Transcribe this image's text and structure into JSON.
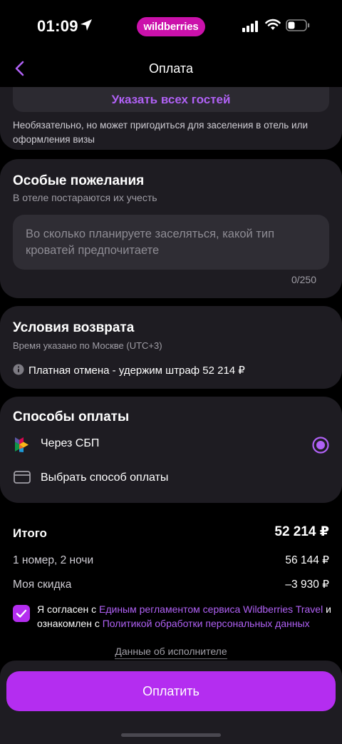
{
  "status_bar": {
    "time": "01:09",
    "brand": "wildberries"
  },
  "header": {
    "title": "Оплата"
  },
  "guests": {
    "button_label": "Указать всех гостей",
    "note": "Необязательно, но может пригодиться для заселения в отель или оформления визы"
  },
  "wishes": {
    "title": "Особые пожелания",
    "subtitle": "В отеле постараются их учесть",
    "placeholder": "Во сколько планируете заселяться, какой тип кроватей предпочитаете",
    "counter": "0/250"
  },
  "refund": {
    "title": "Условия возврата",
    "subtitle": "Время указано по Москве (UTC+3)",
    "text": "Платная отмена - удержим штраф 52 214 ₽"
  },
  "payment": {
    "title": "Способы оплаты",
    "option_sbp": "Через СБП",
    "option_choose": "Выбрать способ оплаты"
  },
  "totals": {
    "title": "Итого",
    "sum": "52 214 ₽",
    "rooms_label": "1 номер, 2 ночи",
    "rooms_value": "56 144 ₽",
    "discount_label": "Моя скидка",
    "discount_value": "–3 930 ₽"
  },
  "agreement": {
    "text1": "Я согласен с ",
    "link1": "Единым регламентом сервиса Wildberries Travel",
    "text2": " и ознакомлен с ",
    "link2": "Политикой обработки персональных данных"
  },
  "contractor_link": "Данные об исполнителе",
  "pay_button": "Оплатить",
  "colors": {
    "accent": "#b42df0",
    "link": "#b061f5",
    "brand": "#cb11ab",
    "card": "#1e1c22"
  }
}
